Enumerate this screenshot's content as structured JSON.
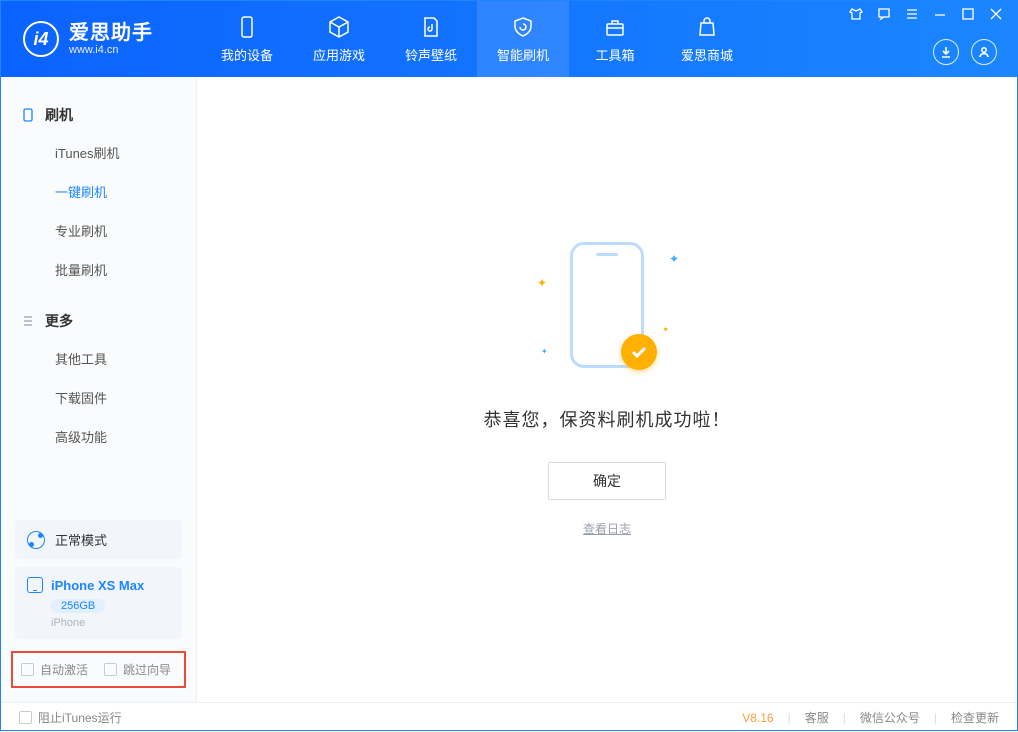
{
  "brand": {
    "title": "爱思助手",
    "site": "www.i4.cn",
    "logo_letter": "i4"
  },
  "tabs": {
    "device": "我的设备",
    "apps": "应用游戏",
    "ringtones": "铃声壁纸",
    "flash": "智能刷机",
    "toolbox": "工具箱",
    "store": "爱思商城"
  },
  "sidebar": {
    "section_flash": "刷机",
    "items_flash": {
      "itunes": "iTunes刷机",
      "onekey": "一键刷机",
      "pro": "专业刷机",
      "batch": "批量刷机"
    },
    "section_more": "更多",
    "items_more": {
      "other_tools": "其他工具",
      "download_fw": "下载固件",
      "advanced": "高级功能"
    },
    "mode": "正常模式",
    "device_name": "iPhone XS Max",
    "device_storage": "256GB",
    "device_type": "iPhone",
    "auto_activate": "自动激活",
    "skip_guide": "跳过向导"
  },
  "main": {
    "success_text": "恭喜您，保资料刷机成功啦！",
    "ok": "确定",
    "view_log": "查看日志"
  },
  "footer": {
    "block_itunes": "阻止iTunes运行",
    "version": "V8.16",
    "support": "客服",
    "wechat": "微信公众号",
    "check_update": "检查更新"
  }
}
